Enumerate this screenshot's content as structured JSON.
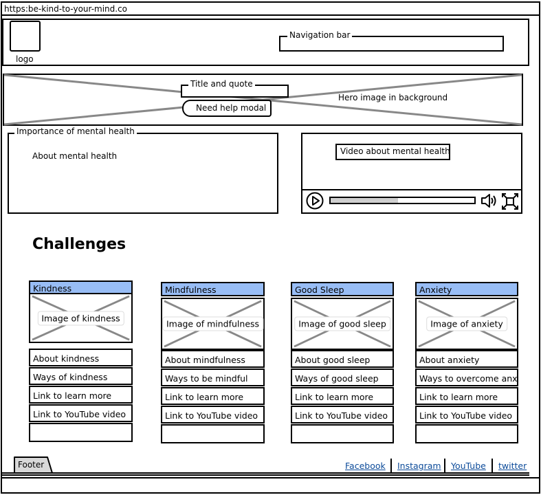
{
  "browser": {
    "url": "https:be-kind-to-your-mind.co"
  },
  "header": {
    "logo_label": "logo",
    "nav_label": "Navigation bar"
  },
  "hero": {
    "title_label": "Title and quote",
    "help_label": "Need help modal",
    "caption": "Hero image in background"
  },
  "importance": {
    "panel_label": "Importance of mental health",
    "body": "About mental health"
  },
  "video": {
    "title": "Video about mental health",
    "progress": 0.47
  },
  "challenges": {
    "title": "Challenges",
    "cards": [
      {
        "heading": "Kindness",
        "image_label": "Image of kindness",
        "rows": [
          "About kindness",
          "Ways of kindness",
          "Link to learn more",
          "Link to YouTube video"
        ]
      },
      {
        "heading": "Mindfulness",
        "image_label": "Image of mindfulness",
        "rows": [
          "About mindfulness",
          "Ways to be mindful",
          "Link to learn more",
          "Link to YouTube video"
        ]
      },
      {
        "heading": "Good Sleep",
        "image_label": "Image of good sleep",
        "rows": [
          "About good sleep",
          "Ways of good sleep",
          "Link to learn more",
          "Link to YouTube video"
        ]
      },
      {
        "heading": "Anxiety",
        "image_label": "Image of anxiety",
        "rows": [
          "About anxiety",
          "Ways to overcome anxie",
          "Link to learn more",
          "Link to YouTube video"
        ]
      }
    ]
  },
  "footer": {
    "label": "Footer",
    "links": {
      "facebook": "Facebook",
      "instagram": "Instagram",
      "youtube": "YouTube",
      "twitter": "twitter"
    }
  },
  "colors": {
    "card_header": "#98bdf5",
    "link": "#0b4a99"
  }
}
